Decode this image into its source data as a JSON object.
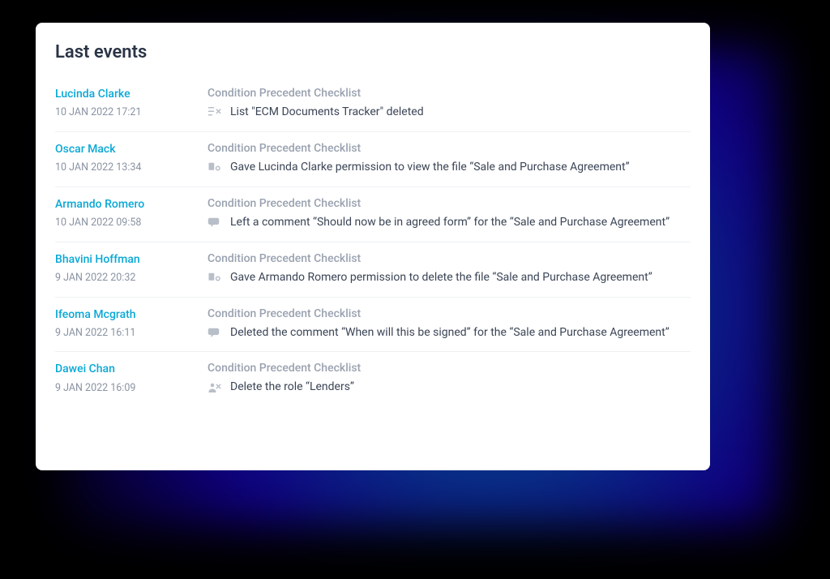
{
  "title": "Last events",
  "events": [
    {
      "user": "Lucinda Clarke",
      "timestamp": "10 JAN 2022 17:21",
      "category": "Condition Precedent Checklist",
      "icon": "list-delete-icon",
      "detail": "List \"ECM Documents Tracker\" deleted"
    },
    {
      "user": "Oscar Mack",
      "timestamp": "10 JAN 2022 13:34",
      "category": "Condition Precedent Checklist",
      "icon": "file-permission-icon",
      "detail": "Gave Lucinda Clarke permission to view the file “Sale and Purchase Agreement”"
    },
    {
      "user": "Armando Romero",
      "timestamp": "10 JAN 2022 09:58",
      "category": "Condition Precedent Checklist",
      "icon": "comment-icon",
      "detail": "Left a comment “Should now be in agreed form” for the “Sale and Purchase Agreement”"
    },
    {
      "user": "Bhavini Hoffman",
      "timestamp": "9 JAN 2022 20:32",
      "category": "Condition Precedent Checklist",
      "icon": "file-permission-icon",
      "detail": "Gave Armando Romero permission to delete the file “Sale and Purchase Agreement”"
    },
    {
      "user": "Ifeoma Mcgrath",
      "timestamp": "9 JAN 2022 16:11",
      "category": "Condition Precedent Checklist",
      "icon": "comment-icon",
      "detail": "Deleted the comment “When will this be signed” for the “Sale and Purchase Agreement”"
    },
    {
      "user": "Dawei Chan",
      "timestamp": "9 JAN 2022 16:09",
      "category": "Condition Precedent Checklist",
      "icon": "role-delete-icon",
      "detail": "Delete the role “Lenders”"
    }
  ]
}
